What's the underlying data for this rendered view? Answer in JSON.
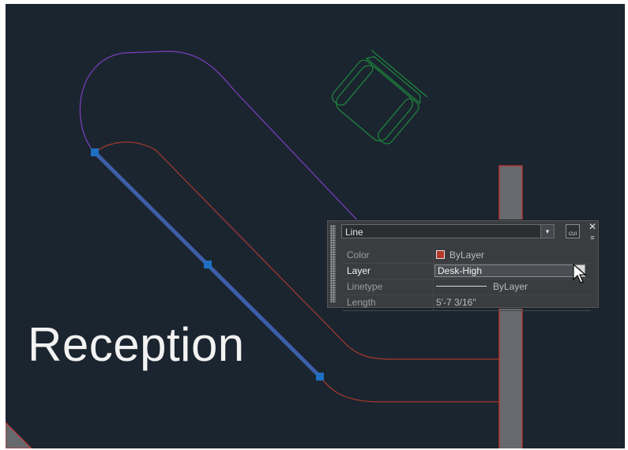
{
  "canvas": {
    "background": "#1b2530",
    "room_label": "Reception"
  },
  "drawing": {
    "selected_line_color": "#3d5fa8",
    "grip_color": "#1f6fc4",
    "desk_color": "#a83a2c",
    "purple_outline_color": "#7c3fbf",
    "chair_color": "#1f8a3c",
    "wall_color": "#666a6f",
    "wall_edge_color": "#d0302b"
  },
  "quick_properties": {
    "object_type": "Line",
    "cui_label": "CUI",
    "close_glyph": "✕",
    "menu_glyph": "≡",
    "rows": [
      {
        "key": "Color",
        "value": "ByLayer"
      },
      {
        "key": "Layer",
        "value": "Desk-High"
      },
      {
        "key": "Linetype",
        "value": "ByLayer"
      },
      {
        "key": "Length",
        "value": "5'-7 3/16\""
      }
    ],
    "dropdown_arrow_glyph": "▾"
  },
  "icons": [
    "grip-handle-icon",
    "dropdown-arrow-icon",
    "cui-icon",
    "close-icon",
    "options-menu-icon",
    "mouse-pointer-icon"
  ]
}
